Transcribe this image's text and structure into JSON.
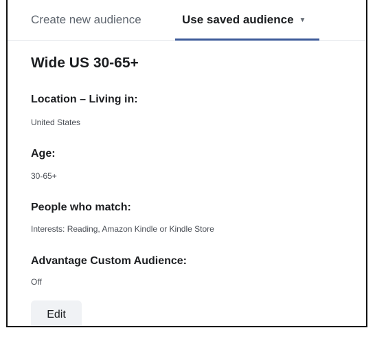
{
  "tabs": {
    "create_label": "Create new audience",
    "saved_label": "Use saved audience"
  },
  "audience": {
    "name": "Wide US 30-65+",
    "location_label": "Location – Living in:",
    "location_value": "United States",
    "age_label": "Age:",
    "age_value": "30-65+",
    "match_label": "People who match:",
    "match_value": "Interests: Reading, Amazon Kindle or Kindle Store",
    "advantage_label": "Advantage Custom Audience:",
    "advantage_value": "Off"
  },
  "actions": {
    "edit_label": "Edit"
  },
  "colors": {
    "active_tab_underline": "#3b5998",
    "button_bg": "#f0f2f5"
  },
  "icons": {
    "saved_tab_dropdown": "caret-down-icon"
  }
}
